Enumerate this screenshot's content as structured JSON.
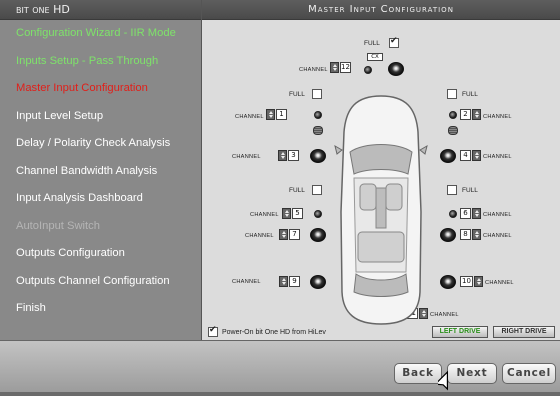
{
  "sidebar": {
    "title": "bit one HD",
    "items": [
      {
        "label": "Configuration Wizard - IIR Mode",
        "state": "done"
      },
      {
        "label": "Inputs Setup - Pass Through",
        "state": "done"
      },
      {
        "label": "Master Input Configuration",
        "state": "active"
      },
      {
        "label": "Input Level Setup",
        "state": "normal"
      },
      {
        "label": "Delay / Polarity Check Analysis",
        "state": "normal"
      },
      {
        "label": "Channel Bandwidth Analysis",
        "state": "normal"
      },
      {
        "label": "Input Analysis Dashboard",
        "state": "normal"
      },
      {
        "label": "AutoInput Switch",
        "state": "disabled"
      },
      {
        "label": "Outputs Configuration",
        "state": "normal"
      },
      {
        "label": "Outputs Channel Configuration",
        "state": "normal"
      },
      {
        "label": "Finish",
        "state": "normal"
      }
    ]
  },
  "main": {
    "title": "Master Input Configuration",
    "channel_label": "CHANNEL",
    "full_label": "FULL",
    "cx_label": "CX",
    "full_center_checked": true,
    "full_front_left_checked": false,
    "full_front_right_checked": false,
    "full_rear_left_checked": false,
    "full_rear_right_checked": false,
    "channels": {
      "center": "12",
      "front_left_tweeter": "1",
      "front_right_tweeter": "2",
      "front_left_woofer": "3",
      "front_right_woofer": "4",
      "rear_left_tweeter": "5",
      "rear_right_tweeter": "6",
      "rear_left_woofer": "7",
      "rear_right_woofer": "8",
      "rear_left_sub": "9",
      "rear_right_sub": "10",
      "subwoofer": "11"
    },
    "power_on_label": "Power-On bit One HD from HiLev",
    "power_on_checked": true,
    "left_drive_label": "LEFT DRIVE",
    "right_drive_label": "RIGHT DRIVE",
    "selected_drive": "left"
  },
  "footer": {
    "back_label": "Back",
    "next_label": "Next",
    "cancel_label": "Cancel"
  },
  "colors": {
    "done": "#7ee36a",
    "active": "#e0201a",
    "disabled": "#b5b5b5",
    "selected_drive": "#2a8f1a"
  }
}
